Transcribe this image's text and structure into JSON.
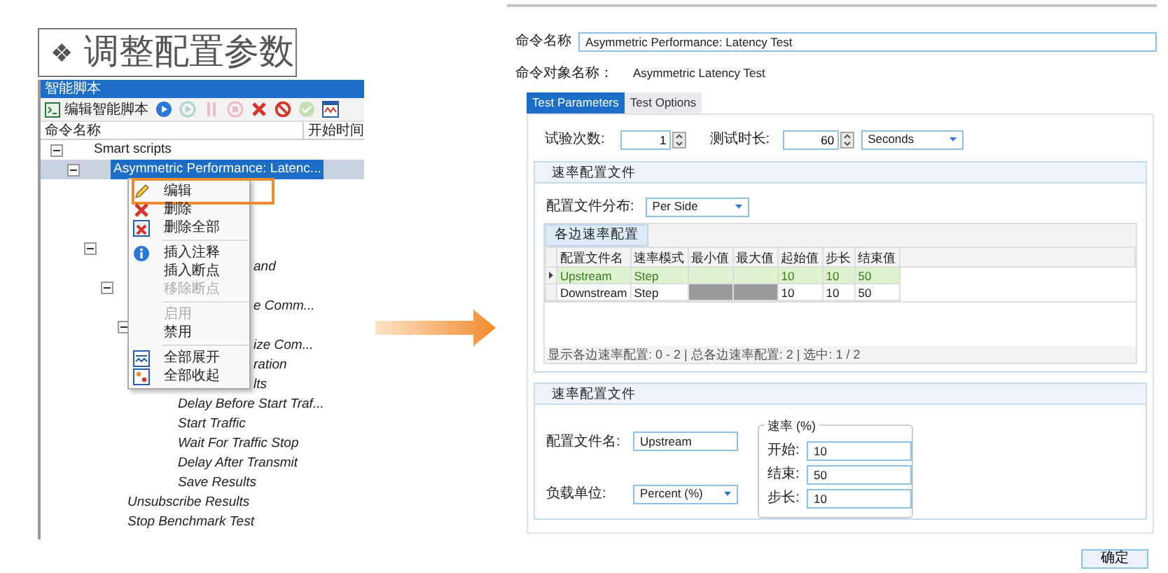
{
  "slide_title": {
    "bullet": "❖",
    "text": "调整配置参数"
  },
  "script_panel": {
    "title": "智能脚本",
    "toolbar": {
      "edit_label": "编辑智能脚本",
      "tools": [
        {
          "kind": "run",
          "disabled": false
        },
        {
          "kind": "step",
          "disabled": true
        },
        {
          "kind": "pause",
          "disabled": true
        },
        {
          "kind": "stop",
          "disabled": true
        },
        {
          "kind": "delete",
          "disabled": false
        },
        {
          "kind": "cancel",
          "disabled": false
        },
        {
          "kind": "check",
          "disabled": true
        },
        {
          "kind": "chart",
          "disabled": false
        }
      ]
    },
    "columns": [
      "命令名称",
      "开始时间"
    ],
    "tree": [
      {
        "kind": "row",
        "label": "Smart scripts",
        "selected": false,
        "expanded": true,
        "children": [
          {
            "kind": "row",
            "label": "Asymmetric Performance: Latenc...",
            "selected": true,
            "expanded": true,
            "children": [
              {
                "kind": "covered"
              },
              {
                "kind": "covered"
              },
              {
                "kind": "covered"
              },
              {
                "kind": "covered",
                "expanded": true,
                "children": [
                  {
                    "kind": "partial",
                    "label": "and",
                    "selected": false
                  },
                  {
                    "kind": "covered",
                    "expanded": true,
                    "children": [
                      {
                        "kind": "partial",
                        "label": "e Comm...",
                        "selected": false
                      },
                      {
                        "kind": "covered",
                        "expanded": true,
                        "children": [
                          {
                            "kind": "partial",
                            "label": "ize Com...",
                            "selected": false
                          },
                          {
                            "kind": "partial",
                            "label": "ration",
                            "selected": false
                          },
                          {
                            "kind": "partial",
                            "label": "lts",
                            "selected": false
                          },
                          {
                            "kind": "row",
                            "label": "Delay Before Start Traf...",
                            "selected": false
                          },
                          {
                            "kind": "row",
                            "label": "Start Traffic",
                            "selected": false
                          },
                          {
                            "kind": "row",
                            "label": "Wait For Traffic Stop",
                            "selected": false
                          },
                          {
                            "kind": "row",
                            "label": "Delay After Transmit",
                            "selected": false
                          },
                          {
                            "kind": "row",
                            "label": "Save Results",
                            "selected": false
                          }
                        ]
                      }
                    ]
                  }
                ]
              },
              {
                "kind": "row",
                "label": "Unsubscribe Results",
                "selected": false
              },
              {
                "kind": "row",
                "label": "Stop Benchmark Test",
                "selected": false
              }
            ]
          }
        ]
      }
    ],
    "context_menu": [
      {
        "kind": "edit",
        "label": "编辑",
        "disabled": false,
        "highlighted": true
      },
      {
        "kind": "delete",
        "label": "删除",
        "disabled": false,
        "highlighted": false
      },
      {
        "kind": "delete-all",
        "label": "删除全部",
        "disabled": false,
        "highlighted": false
      },
      {
        "kind": "separator"
      },
      {
        "kind": "comment",
        "label": "插入注释",
        "disabled": false,
        "highlighted": false
      },
      {
        "kind": "plain",
        "label": "插入断点",
        "disabled": false,
        "highlighted": false
      },
      {
        "kind": "plain",
        "label": "移除断点",
        "disabled": true,
        "highlighted": false
      },
      {
        "kind": "separator"
      },
      {
        "kind": "plain",
        "label": "启用",
        "disabled": true,
        "highlighted": false
      },
      {
        "kind": "plain",
        "label": "禁用",
        "disabled": false,
        "highlighted": false
      },
      {
        "kind": "separator"
      },
      {
        "kind": "expand-all",
        "label": "全部展开",
        "disabled": false,
        "highlighted": false
      },
      {
        "kind": "collapse-all",
        "label": "全部收起",
        "disabled": false,
        "highlighted": false
      }
    ]
  },
  "command_editor": {
    "command_name": {
      "label": "命令名称",
      "value": "Asymmetric Performance: Latency Test"
    },
    "object_name": {
      "label": "命令对象名称：",
      "value": "Asymmetric Latency Test"
    },
    "tabs": [
      {
        "label": "Test Parameters",
        "selected": true
      },
      {
        "label": "Test Options",
        "selected": false
      }
    ],
    "trials": {
      "label": "试验次数:",
      "value": "1"
    },
    "duration": {
      "label": "测试时长:",
      "value": "60",
      "unit": "Seconds"
    },
    "rate_group": {
      "title": "速率配置文件",
      "distribution": {
        "label": "配置文件分布:",
        "value": "Per Side"
      },
      "grid_tab": "各边速率配置",
      "columns": [
        "配置文件名",
        "速率模式",
        "最小值",
        "最大值",
        "起始值",
        "步长",
        "结束值"
      ],
      "rows": [
        {
          "selected": true,
          "cells": [
            {
              "text": "Upstream"
            },
            {
              "text": "Step"
            },
            {
              "kind": "blank"
            },
            {
              "kind": "blank"
            },
            {
              "text": "10"
            },
            {
              "text": "10"
            },
            {
              "text": "50"
            }
          ]
        },
        {
          "selected": false,
          "cells": [
            {
              "text": "Downstream"
            },
            {
              "text": "Step"
            },
            {
              "kind": "disabled"
            },
            {
              "kind": "disabled"
            },
            {
              "text": "10"
            },
            {
              "text": "10"
            },
            {
              "text": "50"
            }
          ]
        }
      ],
      "status": "显示各边速率配置: 0 - 2 | 总各边速率配置: 2 | 选中: 1 / 2"
    },
    "profile_group": {
      "title": "速率配置文件",
      "name": {
        "label": "配置文件名:",
        "value": "Upstream"
      },
      "unit": {
        "label": "负载单位:",
        "value": "Percent (%)"
      },
      "rate": {
        "legend": "速率 (%)",
        "fields": [
          {
            "label": "开始:",
            "value": "10"
          },
          {
            "label": "结束:",
            "value": "50"
          },
          {
            "label": "步长:",
            "value": "10"
          }
        ]
      }
    },
    "ok_button": "确定"
  }
}
